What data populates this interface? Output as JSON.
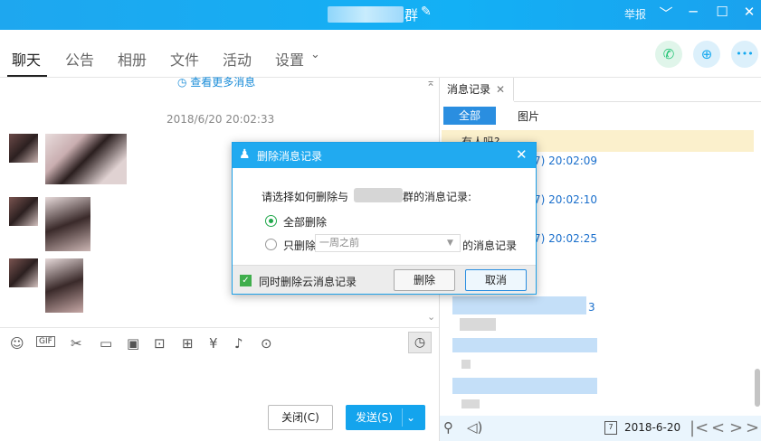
{
  "window": {
    "title_suffix": "群",
    "report_label": "举报",
    "edit_icon": "pencil-icon",
    "minimize_glyph": "─",
    "restore_glyph": "☐",
    "close_glyph": "✕",
    "menu_glyph": "﹀"
  },
  "tabs": [
    {
      "label": "聊天",
      "active": true
    },
    {
      "label": "公告"
    },
    {
      "label": "相册"
    },
    {
      "label": "文件"
    },
    {
      "label": "活动"
    },
    {
      "label": "设置"
    }
  ],
  "tab_dropdown": "⌄",
  "actions": {
    "call_icon": "✆",
    "add_icon": "⊕",
    "more_icon": "•••"
  },
  "chat": {
    "more_messages": "查看更多消息",
    "timestamp": "2018/6/20 20:02:33"
  },
  "toolbar": {
    "gif_label": "GIF"
  },
  "input": {
    "close_label": "关闭(C)",
    "send_label": "发送(S)",
    "send_dropdown": "⌄"
  },
  "history": {
    "tab_label": "消息记录",
    "tab_close": "✕",
    "filter_all": "全部",
    "filter_images": "图片",
    "highlight_text": "有人吗?",
    "times": [
      "7) 20:02:09",
      "7) 20:02:10",
      "7) 20:02:25",
      "3"
    ],
    "date": "2018-6-20",
    "date_icon_num": "7"
  },
  "dialog": {
    "title": "删除消息记录",
    "close_glyph": "✕",
    "prompt_prefix": "请选择如何删除与",
    "prompt_suffix": "群的消息记录:",
    "option_all": "全部删除",
    "option_only_prefix": "只删除",
    "period_value": "一周之前",
    "option_only_suffix": "的消息记录",
    "sync_cloud_label": "同时删除云消息记录",
    "delete_label": "删除",
    "cancel_label": "取消"
  },
  "colors": {
    "titlebar": "#13b0f5",
    "send_button": "#14a4ed",
    "dialog_title": "#21aaf0",
    "highlight": "#fbf0cc",
    "link": "#1a6fcc"
  }
}
